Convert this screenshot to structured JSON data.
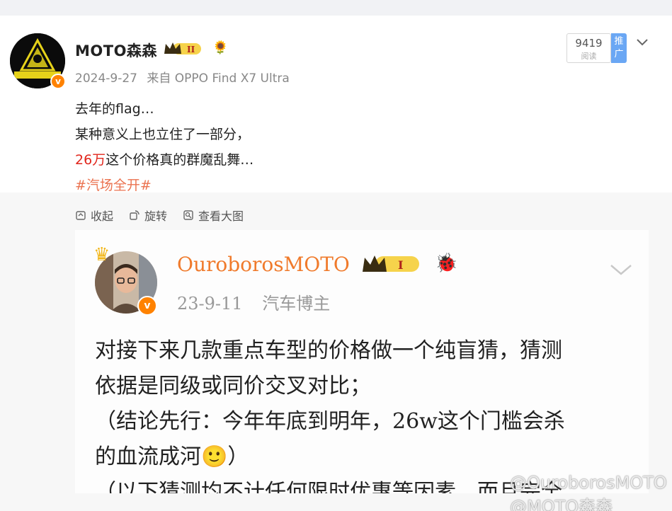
{
  "post": {
    "username": "MOTO森森",
    "level_badge": "II",
    "date": "2024-9-27",
    "source": "来自 OPPO Find X7 Ultra",
    "views_count": "9419",
    "views_label": "阅读",
    "promo_label": "推广",
    "content": {
      "line1": "去年的flag…",
      "line2": "某种意义上也立住了一部分，",
      "line3_highlight": "26万",
      "line3_rest": "这个价格真的群魔乱舞…",
      "hashtag": "#汽场全开#"
    }
  },
  "actions": {
    "collapse": "收起",
    "rotate": "旋转",
    "view_large": "查看大图"
  },
  "embedded": {
    "username": "OuroborosMOTO",
    "level_badge": "I",
    "date": "23-9-11",
    "role": "汽车博主",
    "text_line1": "对接下来几款重点车型的价格做一个纯盲猜，猜测",
    "text_line2": "依据是同级或同价交叉对比；",
    "text_line3": "（结论先行：今年年底到明年，26w这个门槛会杀",
    "text_line4": "的血流成河🙂）",
    "text_line5": "（以下猜测均不计任何限时优惠等因素，而且完全"
  },
  "watermark": "@OuroborosMOTO @MOTO森森",
  "avatar_text": "@MOTO森森",
  "colors": {
    "accent_orange": "#ff8200",
    "highlight_red": "#e1251b",
    "hashtag": "#eb7350",
    "promo_blue": "#6aa7f4"
  },
  "icons": [
    "collapse-icon",
    "rotate-icon",
    "view-large-icon",
    "chevron-down-icon",
    "verified-icon",
    "crown-icon",
    "flower-icon"
  ]
}
